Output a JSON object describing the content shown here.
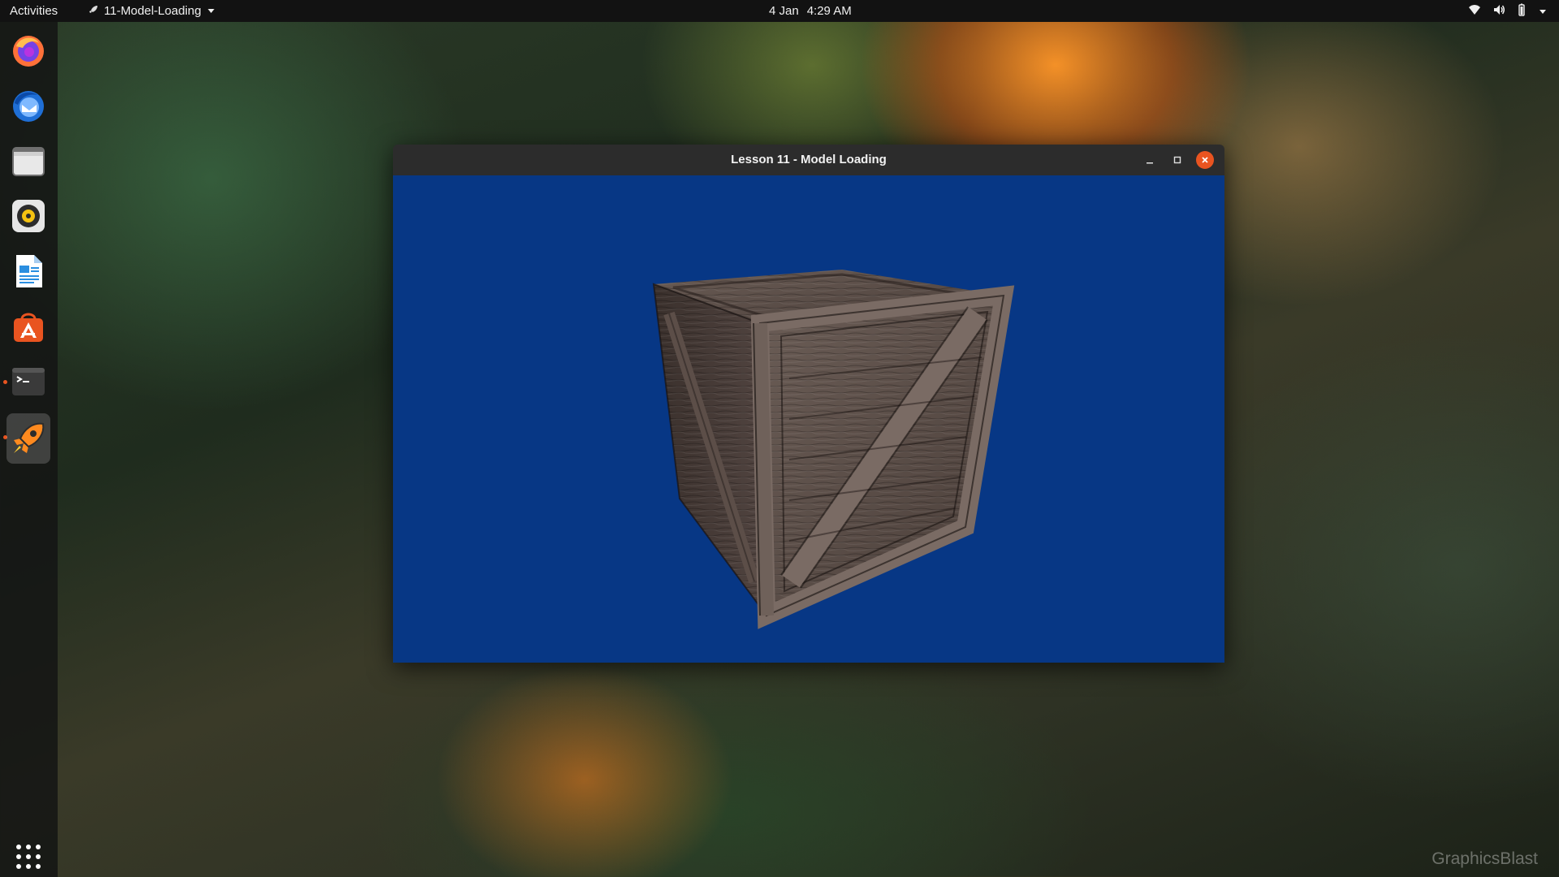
{
  "topbar": {
    "activities_label": "Activities",
    "app_name": "11-Model-Loading",
    "date": "4 Jan",
    "time": "4:29 AM"
  },
  "dock": {
    "items": [
      {
        "name": "Firefox",
        "icon": "firefox-icon"
      },
      {
        "name": "Thunderbird",
        "icon": "thunderbird-icon"
      },
      {
        "name": "Files",
        "icon": "files-icon"
      },
      {
        "name": "Rhythmbox",
        "icon": "rhythmbox-icon"
      },
      {
        "name": "LibreOffice Writer",
        "icon": "writer-icon"
      },
      {
        "name": "Ubuntu Software",
        "icon": "software-icon"
      },
      {
        "name": "Terminal",
        "icon": "terminal-icon"
      },
      {
        "name": "11-Model-Loading",
        "icon": "rocket-icon"
      }
    ],
    "show_apps_icon": "grid-icon"
  },
  "window": {
    "title": "Lesson 11 - Model Loading",
    "viewport_color": "#073785"
  },
  "watermark": "GraphicsBlast",
  "colors": {
    "accent": "#e95420",
    "topbar": "#121212"
  }
}
